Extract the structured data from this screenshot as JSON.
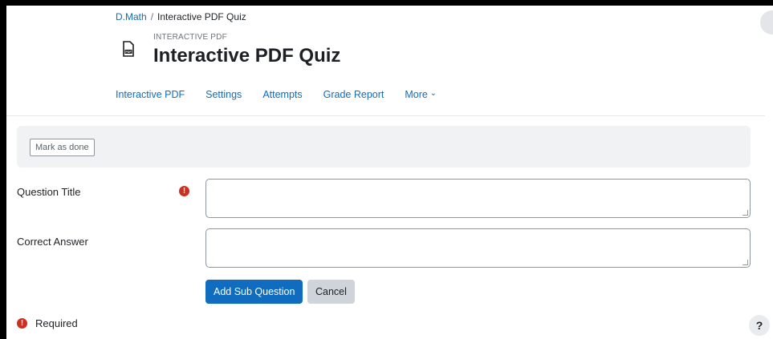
{
  "breadcrumb": {
    "course": "D.Math",
    "separator": "/",
    "current": "Interactive PDF Quiz"
  },
  "activity": {
    "icon": "pdf-file-icon",
    "eyebrow": "INTERACTIVE PDF",
    "title": "Interactive PDF Quiz"
  },
  "nav": {
    "tabs": [
      {
        "label": "Interactive PDF"
      },
      {
        "label": "Settings"
      },
      {
        "label": "Attempts"
      },
      {
        "label": "Grade Report"
      },
      {
        "label": "More"
      }
    ]
  },
  "completion": {
    "mark_done_label": "Mark as done"
  },
  "form": {
    "question_title": {
      "label": "Question Title",
      "value": "",
      "required": true
    },
    "correct_answer": {
      "label": "Correct Answer",
      "value": ""
    },
    "submit_label": "Add Sub Question",
    "cancel_label": "Cancel",
    "required_note": "Required"
  },
  "help": {
    "label": "?"
  },
  "colors": {
    "link": "#0f6cbf",
    "primary_button": "#0f6cbf",
    "required_icon": "#ca3120",
    "secondary_button": "#ced4da"
  }
}
